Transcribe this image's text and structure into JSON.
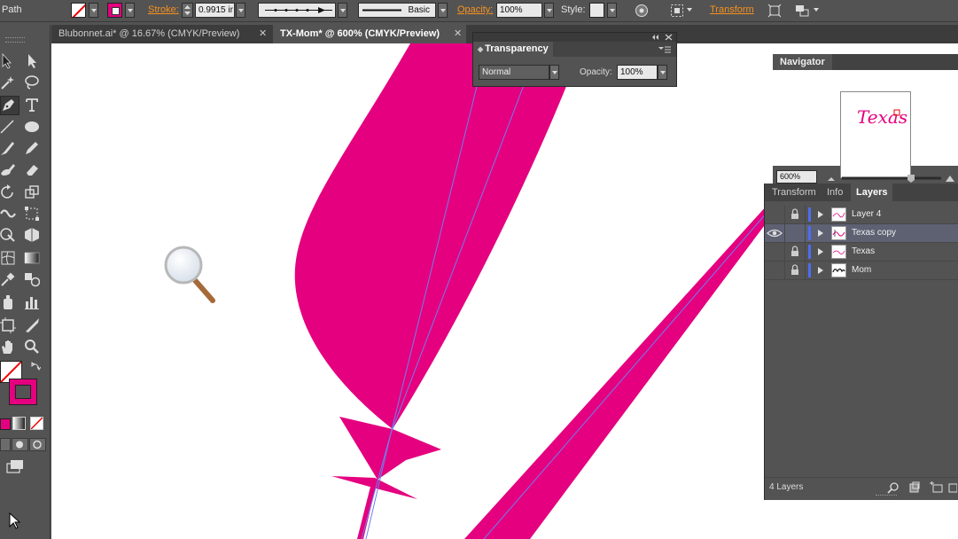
{
  "control_bar": {
    "selection_label": "Path",
    "stroke_label": "Stroke:",
    "stroke_weight": "0.9915 ir",
    "brush_label": "Basic",
    "opacity_label": "Opacity:",
    "opacity_value": "100%",
    "style_label": "Style:",
    "transform_label": "Transform"
  },
  "tabs": [
    {
      "label": "Blubonnet.ai* @ 16.67% (CMYK/Preview)",
      "close": "✕",
      "active": false
    },
    {
      "label": "TX-Mom* @ 600% (CMYK/Preview)",
      "close": "✕",
      "active": true
    }
  ],
  "transparency_panel": {
    "title": "Transparency",
    "blend_mode": "Normal",
    "opacity_label": "Opacity:",
    "opacity_value": "100%"
  },
  "navigator_panel": {
    "title": "Navigator",
    "zoom_value": "600%",
    "thumb_text": "Texas"
  },
  "layers_panel": {
    "tabs": [
      "Transform",
      "Info",
      "Layers"
    ],
    "active_tab": "Layers",
    "layers": [
      {
        "name": "Layer 4",
        "visible": false,
        "locked": true,
        "selected": false
      },
      {
        "name": "Texas copy",
        "visible": true,
        "locked": false,
        "selected": true
      },
      {
        "name": "Texas",
        "visible": false,
        "locked": true,
        "selected": false
      },
      {
        "name": "Mom",
        "visible": false,
        "locked": true,
        "selected": false
      }
    ],
    "footer_count": "4 Layers"
  },
  "colors": {
    "artwork_magenta": "#e4007f",
    "path_guide": "#6f7ff0",
    "accent_orange": "#f7921e",
    "ui_gray": "#535353"
  }
}
